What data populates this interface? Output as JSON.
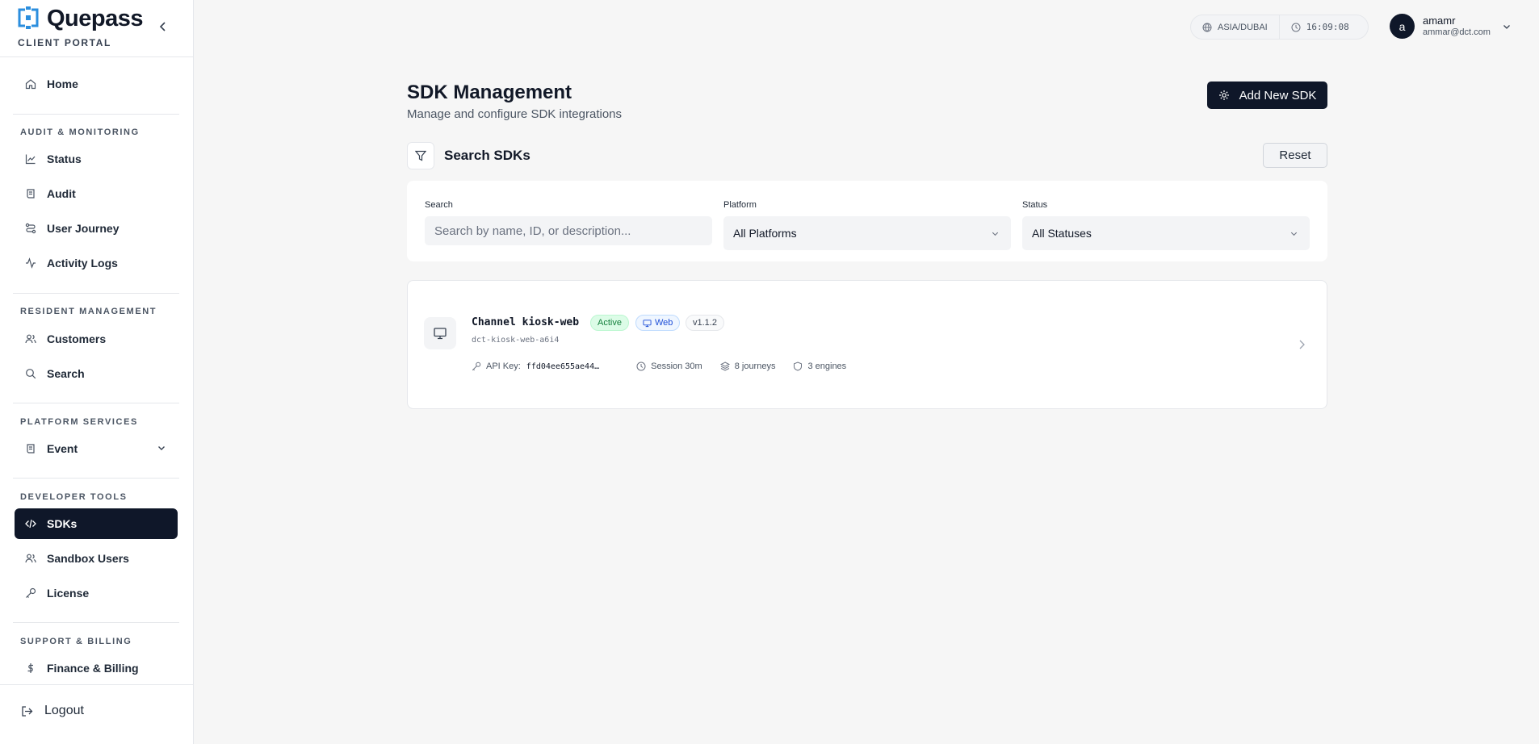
{
  "brand": {
    "name": "Quepass",
    "subtitle": "CLIENT PORTAL"
  },
  "sidebar": {
    "home": "Home",
    "sections": [
      {
        "label": "AUDIT & MONITORING",
        "items": [
          "Status",
          "Audit",
          "User Journey",
          "Activity Logs"
        ]
      },
      {
        "label": "RESIDENT MANAGEMENT",
        "items": [
          "Customers",
          "Search"
        ]
      },
      {
        "label": "PLATFORM SERVICES",
        "items": [
          "Event"
        ]
      },
      {
        "label": "DEVELOPER TOOLS",
        "items": [
          "SDKs",
          "Sandbox Users",
          "License"
        ]
      },
      {
        "label": "SUPPORT & BILLING",
        "items": [
          "Finance & Billing"
        ]
      }
    ],
    "active_item": "SDKs",
    "logout": "Logout"
  },
  "topbar": {
    "timezone": "ASIA/DUBAI",
    "time": "16:09:08",
    "user": {
      "initial": "a",
      "name": "amamr",
      "email": "ammar@dct.com"
    }
  },
  "page": {
    "title": "SDK Management",
    "subtitle": "Manage and configure SDK integrations",
    "add_button": "Add New SDK"
  },
  "filters": {
    "title": "Search SDKs",
    "reset": "Reset",
    "search": {
      "label": "Search",
      "placeholder": "Search by name, ID, or description...",
      "value": ""
    },
    "platform": {
      "label": "Platform",
      "value": "All Platforms"
    },
    "status": {
      "label": "Status",
      "value": "All Statuses"
    }
  },
  "sdks": [
    {
      "name": "Channel kiosk-web",
      "status": "Active",
      "platform": "Web",
      "version": "v1.1.2",
      "id": "dct-kiosk-web-a6i4",
      "api_key_label": "API Key:",
      "api_key": "ffd04ee655ae44…",
      "session": "Session 30m",
      "journeys": "8 journeys",
      "engines": "3 engines"
    }
  ],
  "colors": {
    "primary": "#0f1729",
    "brand_blue": "#2b8ede",
    "active_green": "#15803d",
    "web_blue": "#1d4ed8"
  }
}
